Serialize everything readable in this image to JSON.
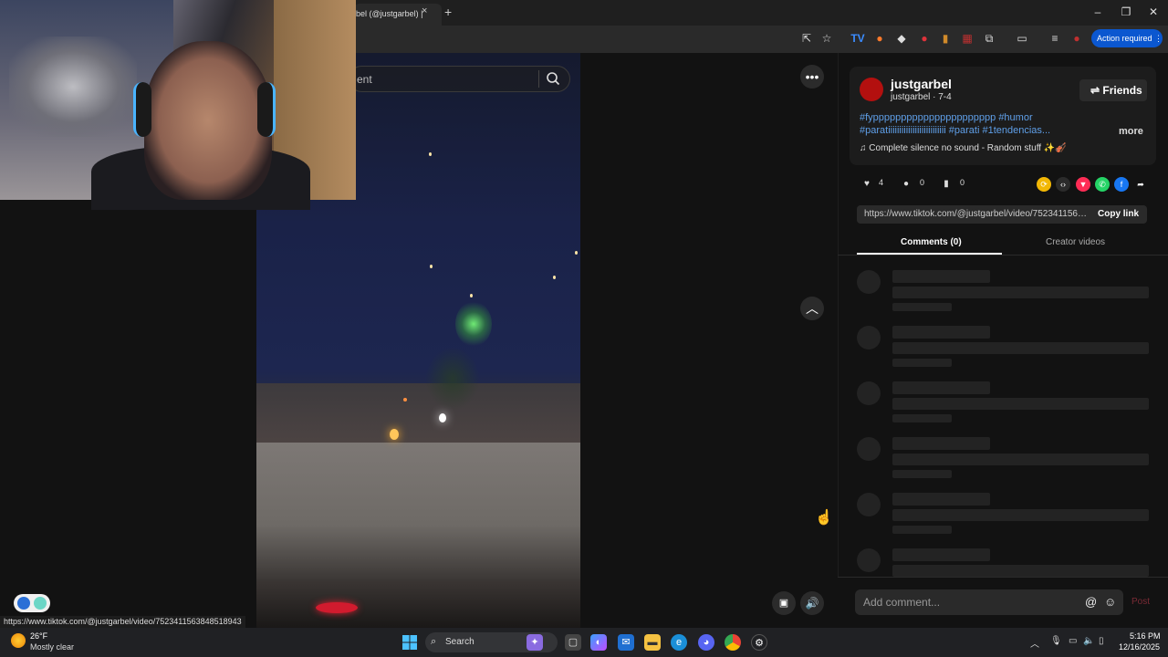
{
  "browser": {
    "tab_title": "bel (@justgarbel) |",
    "tab_close": "×",
    "new_tab": "+",
    "action_required": "Action required"
  },
  "search": {
    "placeholder_visible": "ent"
  },
  "video": {},
  "panel": {
    "username": "justgarbel",
    "subline": "justgarbel · 7-4",
    "friends_label": "Friends",
    "tags_line1": "#fypppppppppppppppppppppp #humor",
    "tags_line2": "#paratiiiiiiiiiiiiiiiiiiiiiiiiii #parati #1tendencias...",
    "more_label": "more",
    "sound": "Complete silence no sound - Random stuff ✨🎻",
    "likes": "4",
    "comments_count": "0",
    "saves": "0",
    "link": "https://www.tiktok.com/@justgarbel/video/7523411563...",
    "copy_link": "Copy link",
    "tab_comments": "Comments (0)",
    "tab_creator": "Creator videos",
    "comment_placeholder": "Add comment...",
    "post_label": "Post"
  },
  "status_url": "https://www.tiktok.com/@justgarbel/video/7523411563848518943",
  "taskbar": {
    "temperature": "26°F",
    "condition": "Mostly clear",
    "search_label": "Search",
    "time": "5:16 PM",
    "date": "12/16/2025"
  },
  "colors": {
    "accent": "#0b57d0",
    "hashtag": "#5f9fe8",
    "avatar": "#b3100f"
  }
}
